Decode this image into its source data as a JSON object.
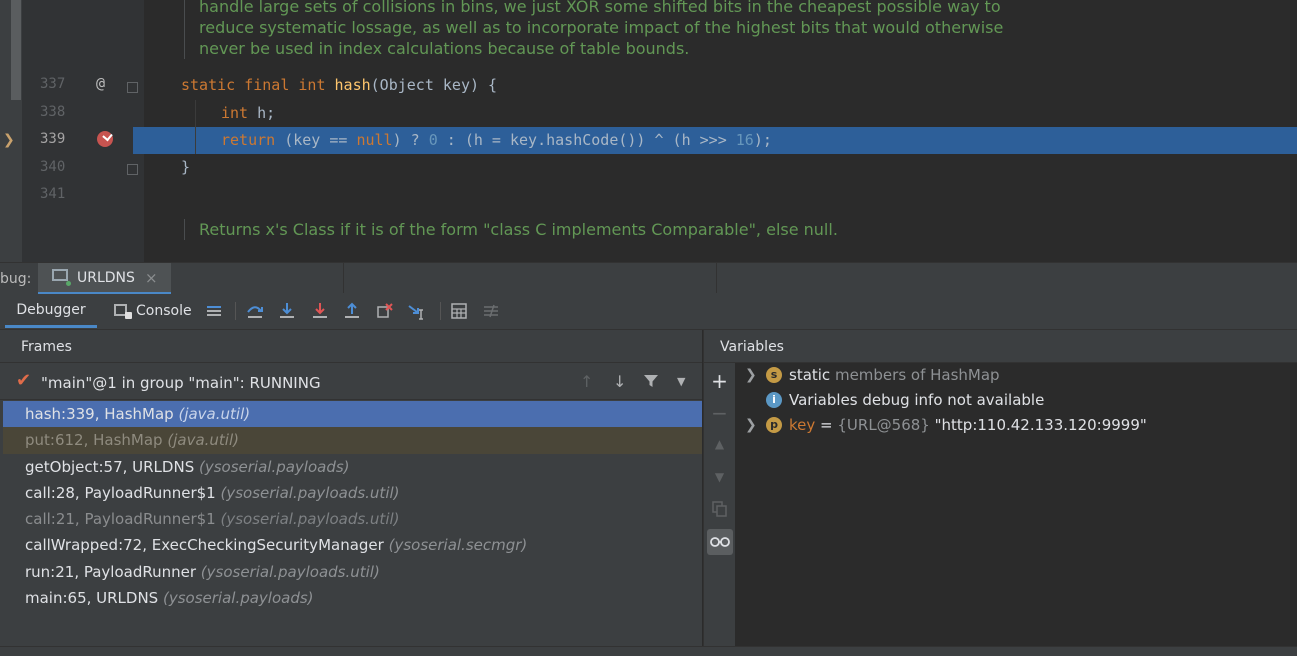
{
  "editor": {
    "doc_top_lines": [
      "handle large sets of collisions in bins, we just XOR some shifted bits in the cheapest possible way to",
      "reduce systematic lossage, as well as to incorporate impact of the highest bits that would otherwise",
      "never be used in index calculations because of table bounds."
    ],
    "line_numbers": [
      "337",
      "338",
      "339",
      "340",
      "341"
    ],
    "gutter_annotation": "@",
    "code": {
      "l337": {
        "kw": "static final int ",
        "fn": "hash",
        "rest": "(Object key) {"
      },
      "l338": {
        "kw": "int ",
        "rest": "h;"
      },
      "l339": {
        "kw_return": "return ",
        "p1": "(key == ",
        "kw_null": "null",
        "p2": ") ? ",
        "num0": "0",
        "p3": " : (h = key.hashCode()) ^ (h >>> ",
        "num16": "16",
        "p4": ");"
      },
      "l340": "}"
    },
    "doc_bottom": "Returns x's Class if it is of the form \"class C implements Comparable\", else null."
  },
  "debug": {
    "window_title": "bug:",
    "run_tab": "URLDNS",
    "close_glyph": "×",
    "subtabs": {
      "debugger": "Debugger",
      "console": "Console"
    },
    "frames": {
      "header": "Frames",
      "thread": "\"main\"@1 in group \"main\": RUNNING",
      "items": [
        {
          "method": "hash:339, HashMap ",
          "pkg": "(java.util)"
        },
        {
          "method": "put:612, HashMap ",
          "pkg": "(java.util)"
        },
        {
          "method": "getObject:57, URLDNS ",
          "pkg": "(ysoserial.payloads)"
        },
        {
          "method": "call:28, PayloadRunner$1 ",
          "pkg": "(ysoserial.payloads.util)"
        },
        {
          "method": "call:21, PayloadRunner$1 ",
          "pkg": "(ysoserial.payloads.util)"
        },
        {
          "method": "callWrapped:72, ExecCheckingSecurityManager ",
          "pkg": "(ysoserial.secmgr)"
        },
        {
          "method": "run:21, PayloadRunner ",
          "pkg": "(ysoserial.payloads.util)"
        },
        {
          "method": "main:65, URLDNS ",
          "pkg": "(ysoserial.payloads)"
        }
      ]
    },
    "variables": {
      "header": "Variables",
      "items": [
        {
          "badge": "s",
          "name": "static",
          "detail": " members of HashMap"
        },
        {
          "badge": "i",
          "text": "Variables debug info not available"
        },
        {
          "badge": "p",
          "name": "key",
          "eq": " = ",
          "ref": "{URL@568} ",
          "value": "\"http:110.42.133.120:9999\""
        }
      ]
    }
  },
  "colors": {
    "editor_bg": "#2b2b2b",
    "panel_bg": "#3c3f41",
    "selection": "#4b6eaf",
    "execution_line": "#2d5f99",
    "keyword": "#cc7832",
    "doc_comment": "#629755",
    "breakpoint": "#c75450"
  }
}
